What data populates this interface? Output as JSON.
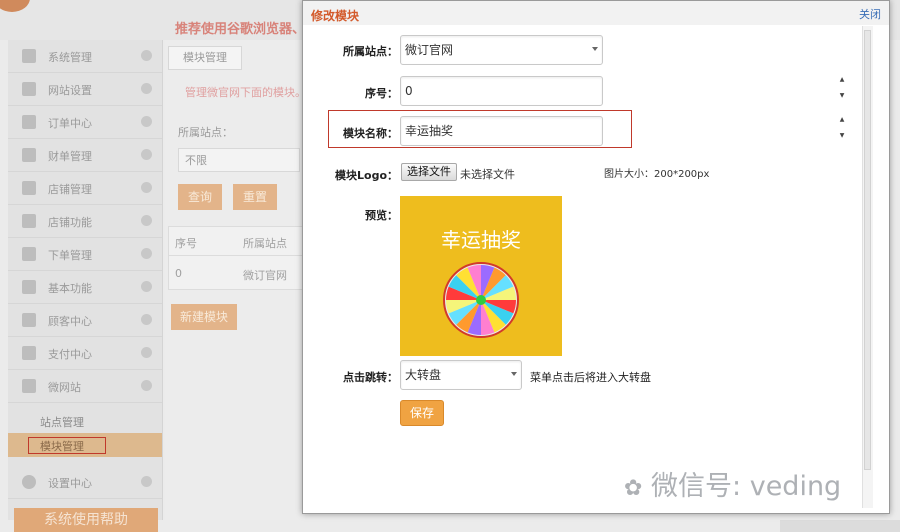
{
  "background_app": {
    "banner": "推荐使用谷歌浏览器、",
    "sidebar": {
      "items": [
        {
          "label": "系统管理",
          "icon": "grid-icon"
        },
        {
          "label": "网站设置",
          "icon": "mail-icon"
        },
        {
          "label": "订单中心",
          "icon": "cart-icon"
        },
        {
          "label": "财单管理",
          "icon": "cart-icon"
        },
        {
          "label": "店铺管理",
          "icon": "store-icon"
        },
        {
          "label": "店铺功能",
          "icon": "plus-icon"
        },
        {
          "label": "下单管理",
          "icon": "plus-icon"
        },
        {
          "label": "基本功能",
          "icon": "plus-icon"
        },
        {
          "label": "顾客中心",
          "icon": "inbox-icon"
        },
        {
          "label": "支付中心",
          "icon": "inbox-icon"
        },
        {
          "label": "微网站",
          "icon": "chart-icon"
        }
      ],
      "sub_items": [
        "站点管理",
        "模块管理"
      ],
      "settings": "设置中心",
      "bottom_button": "系统使用帮助"
    },
    "tab": "模块管理",
    "hint": "管理微官网下面的模块。",
    "site_label": "所属站点：",
    "site_select": "不限",
    "query_button": "查询",
    "clear_button": "重置",
    "table": {
      "headers": [
        "序号",
        "所属站点"
      ],
      "rows": [
        [
          "0",
          "微订官网"
        ]
      ]
    },
    "new_module_button": "新建模块"
  },
  "dialog": {
    "title": "修改模块",
    "close": "关闭",
    "site_label": "所属站点：",
    "site_value": "微订官网",
    "order_label": "序号：",
    "order_value": "0",
    "name_label": "模块名称：",
    "name_value": "幸运抽奖",
    "logo_label": "模块Logo：",
    "file_button": "选择文件",
    "file_status": "未选择文件",
    "size_hint": "图片大小：200*200px",
    "preview_label": "预览：",
    "preview_title": "幸运抽奖",
    "jump_label": "点击跳转：",
    "jump_value": "大转盘",
    "jump_hint": "菜单点击后将进入大转盘",
    "save_button": "保存"
  },
  "wheel_colors": [
    "#ff3b3b",
    "#3ad1f0",
    "#ffe033",
    "#ff7fd0",
    "#9b6bff",
    "#ff9a2e",
    "#66e0ff",
    "#f5f57a"
  ],
  "accent": "#f0a342",
  "watermark": "微信号: veding"
}
